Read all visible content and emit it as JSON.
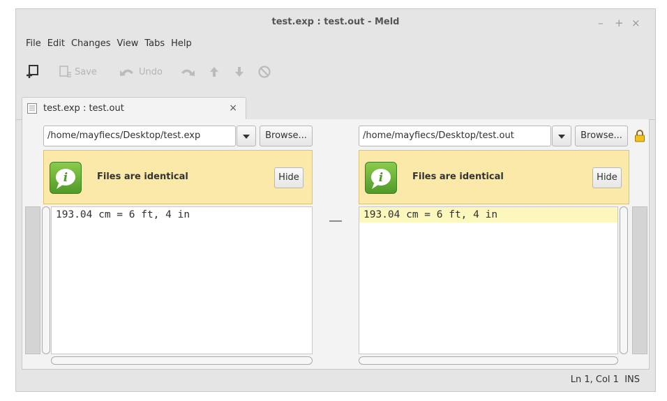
{
  "window": {
    "title": "test.exp : test.out - Meld",
    "controls": [
      "–",
      "+",
      "×"
    ]
  },
  "menubar": [
    "File",
    "Edit",
    "Changes",
    "View",
    "Tabs",
    "Help"
  ],
  "toolbar": {
    "save_label": "Save",
    "undo_label": "Undo"
  },
  "tab": {
    "label": "test.exp : test.out",
    "close": "×"
  },
  "left_pane": {
    "path": "/home/mayfiecs/Desktop/test.exp",
    "browse_label": "Browse...",
    "info_message": "Files are identical",
    "hide_label": "Hide",
    "lines": [
      "193.04 cm = 6 ft, 4 in"
    ]
  },
  "right_pane": {
    "path": "/home/mayfiecs/Desktop/test.out",
    "browse_label": "Browse...",
    "info_message": "Files are identical",
    "hide_label": "Hide",
    "lines": [
      "193.04 cm = 6 ft, 4 in"
    ]
  },
  "status": {
    "position": "Ln 1, Col 1",
    "mode": "INS"
  },
  "colors": {
    "info_bar": "#fbe9a9",
    "current_line": "#fcf7bd",
    "window_bg": "#e5e5e5"
  },
  "icons": [
    "new-comparison-icon",
    "save-icon",
    "undo-icon",
    "redo-icon",
    "up-arrow-icon",
    "down-arrow-icon",
    "stop-icon",
    "document-icon",
    "info-icon",
    "lock-icon"
  ]
}
